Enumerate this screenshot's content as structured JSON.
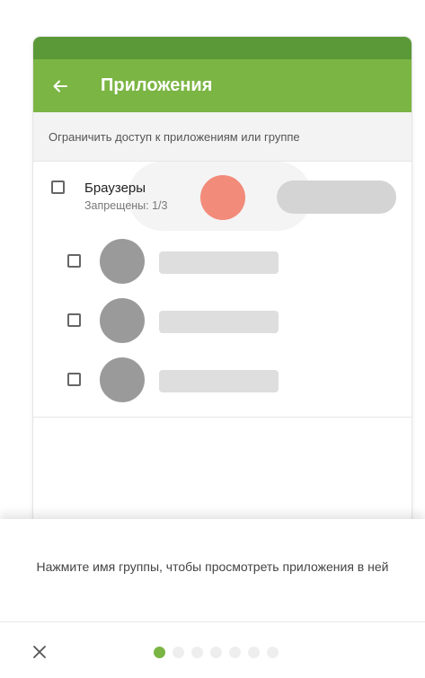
{
  "app_bar": {
    "title": "Приложения",
    "back_icon": "arrow-left-icon",
    "color": "#7bb544",
    "status_color": "#5b9838"
  },
  "subheader": {
    "text": "Ограничить доступ к приложениям или группе"
  },
  "group": {
    "name": "Браузеры",
    "subtitle": "Запрещены: 1/3",
    "checked": false
  },
  "apps": [
    {
      "checked": false
    },
    {
      "checked": false
    },
    {
      "checked": false
    }
  ],
  "tutorial": {
    "hint": "Нажмите имя группы, чтобы просмотреть приложения в ней",
    "close_icon": "close-icon",
    "pages_total": 7,
    "current_page": 1,
    "accent": "#7bb544"
  }
}
